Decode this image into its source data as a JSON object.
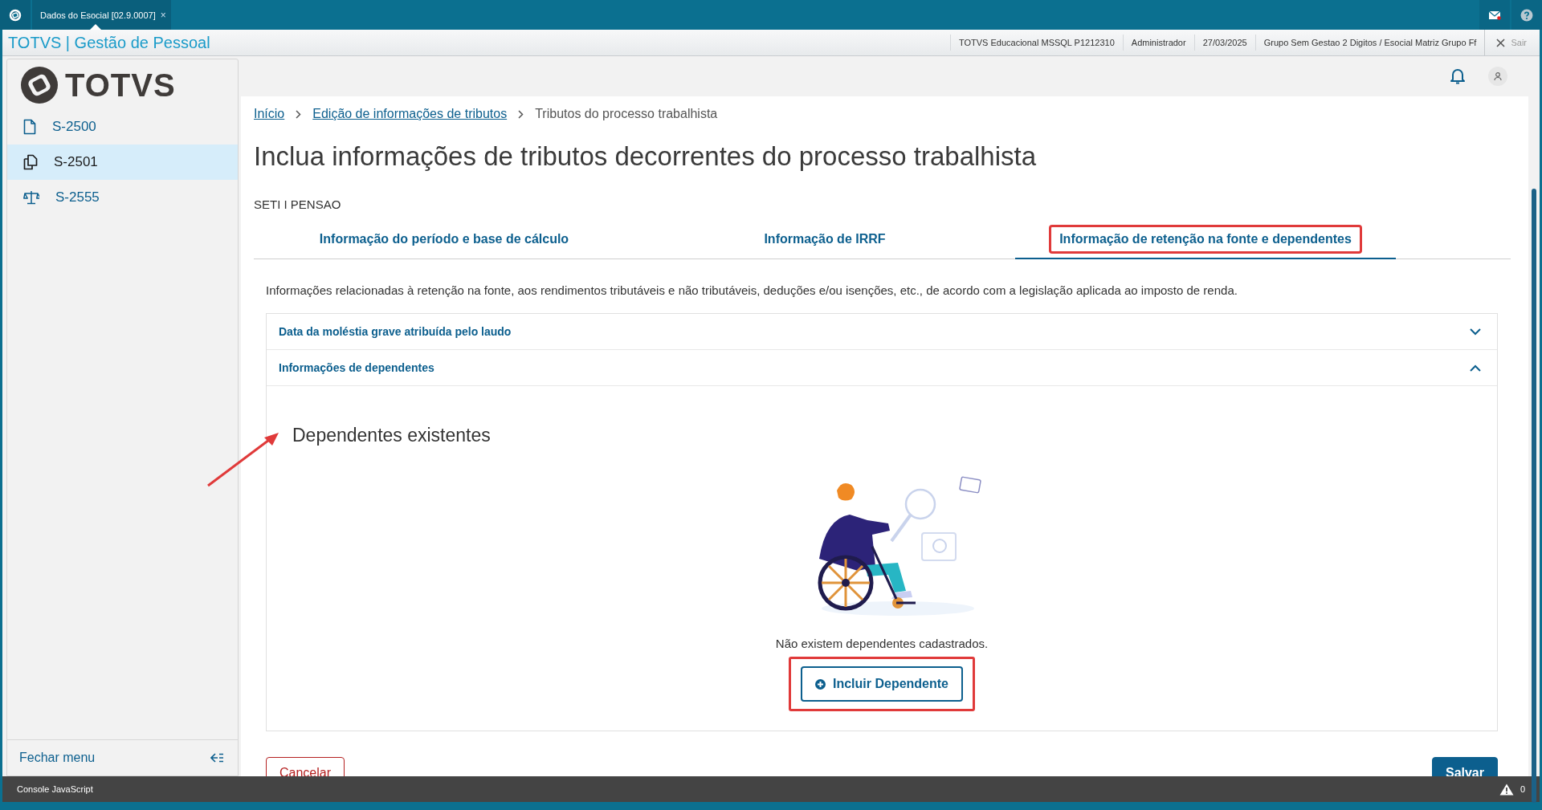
{
  "window": {
    "tab": "Dados do Esocial [02.9.0007]",
    "tab_close": "×"
  },
  "app_bar": {
    "title": "TOTVS | Gestão de Pessoal",
    "info": [
      "TOTVS Educacional MSSQL P1212310",
      "Administrador",
      "27/03/2025",
      "Grupo Sem Gestao 2 Digitos / Esocial Matriz Grupo Ff"
    ],
    "exit": "Sair"
  },
  "sidebar": {
    "logo": "TOTVS",
    "items": [
      {
        "label": "S-2500",
        "kind": "file",
        "selected": false
      },
      {
        "label": "S-2501",
        "kind": "copy",
        "selected": true
      },
      {
        "label": "S-2555",
        "kind": "scale",
        "selected": false
      }
    ],
    "collapse": "Fechar menu"
  },
  "breadcrumb": [
    {
      "label": "Início",
      "link": true
    },
    {
      "label": "Edição de informações de tributos",
      "link": true
    },
    {
      "label": "Tributos do processo trabalhista",
      "link": false
    }
  ],
  "heading": "Inclua informações de tributos decorrentes do processo trabalhista",
  "subtitle": "SETI I PENSAO",
  "tabs": [
    {
      "label": "Informação do período e base de cálculo",
      "selected": false,
      "highlighted": false
    },
    {
      "label": "Informação de IRRF",
      "selected": false,
      "highlighted": false
    },
    {
      "label": "Informação de retenção na fonte e dependentes",
      "selected": true,
      "highlighted": true
    }
  ],
  "description": "Informações relacionadas à retenção na fonte, aos rendimentos tributáveis e não tributáveis, deduções e/ou isenções, etc., de acordo com a legislação aplicada ao imposto de renda.",
  "accordion": [
    {
      "label": "Data da moléstia grave atribuída pelo laudo",
      "expanded": false
    },
    {
      "label": "Informações de dependentes",
      "expanded": true
    }
  ],
  "dependents": {
    "title": "Dependentes existentes",
    "empty_message": "Não existem dependentes cadastrados.",
    "add_button": {
      "label": "Incluir Dependente",
      "highlighted": true
    }
  },
  "actions": [
    "Cancelar",
    "Salvar"
  ],
  "console": {
    "label": "Console JavaScript",
    "warnings": "0"
  }
}
